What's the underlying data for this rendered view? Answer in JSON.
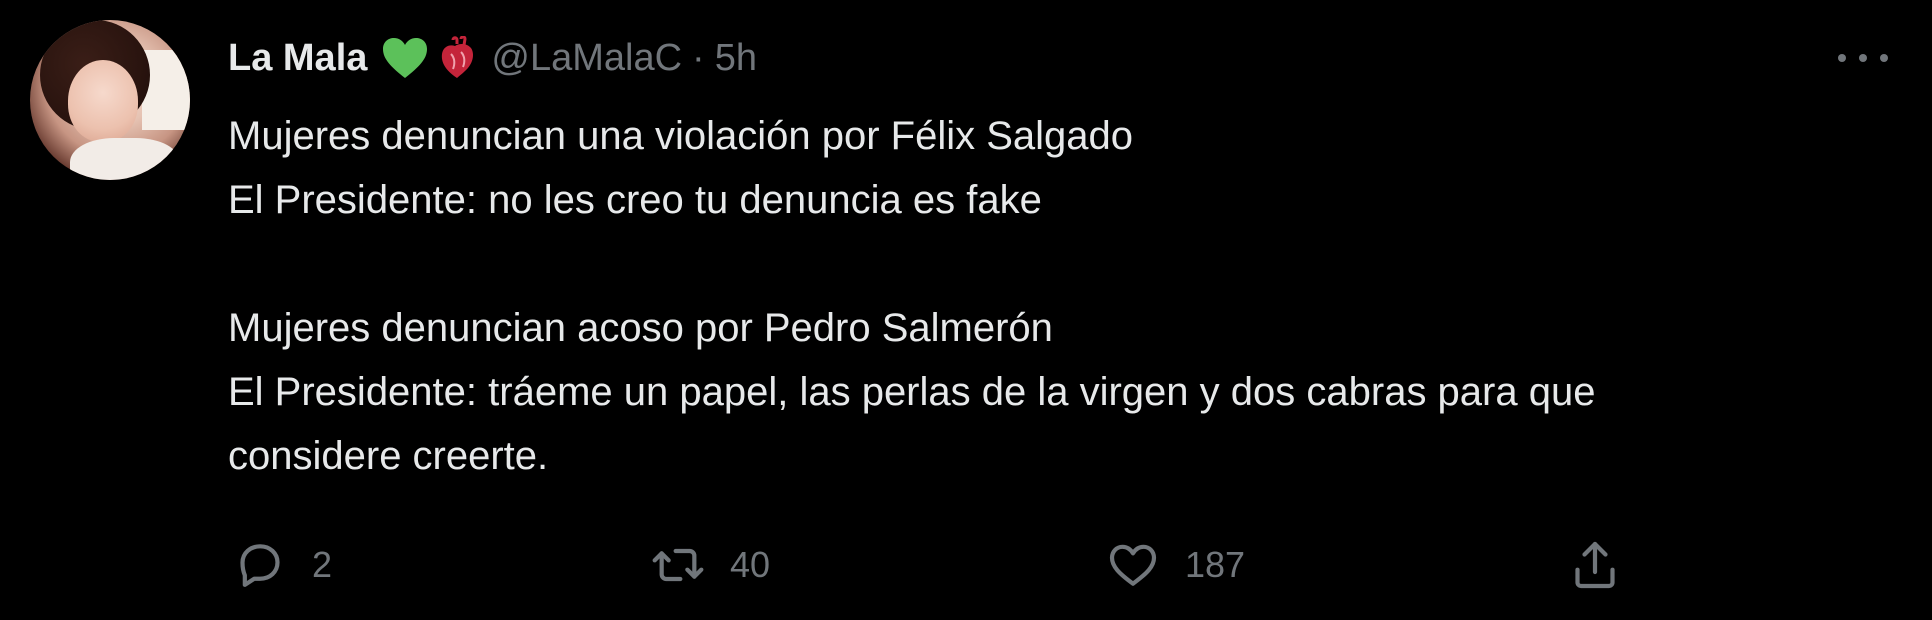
{
  "tweet": {
    "display_name": "La Mala",
    "emojis": [
      "green-heart-emoji",
      "anatomical-heart-emoji"
    ],
    "handle": "@LaMalaC",
    "separator": "·",
    "time": "5h",
    "more_icon": "more-horizontal-icon",
    "lines": [
      "Mujeres denuncian una violación por Félix Salgado",
      "El Presidente: no les creo tu denuncia es fake",
      "",
      "Mujeres denuncian acoso por Pedro Salmerón",
      "El Presidente: tráeme un papel, las perlas de la virgen y dos cabras para que",
      "considere creerte."
    ]
  },
  "actions": {
    "reply": {
      "icon": "reply-icon",
      "count": "2"
    },
    "retweet": {
      "icon": "retweet-icon",
      "count": "40"
    },
    "like": {
      "icon": "heart-icon",
      "count": "187"
    },
    "share": {
      "icon": "share-icon",
      "count": ""
    }
  },
  "colors": {
    "background": "#000000",
    "text": "#e7e9ea",
    "secondary": "#71767b",
    "green_heart": "#5cc15a",
    "anatomical_heart": "#c4243a"
  }
}
